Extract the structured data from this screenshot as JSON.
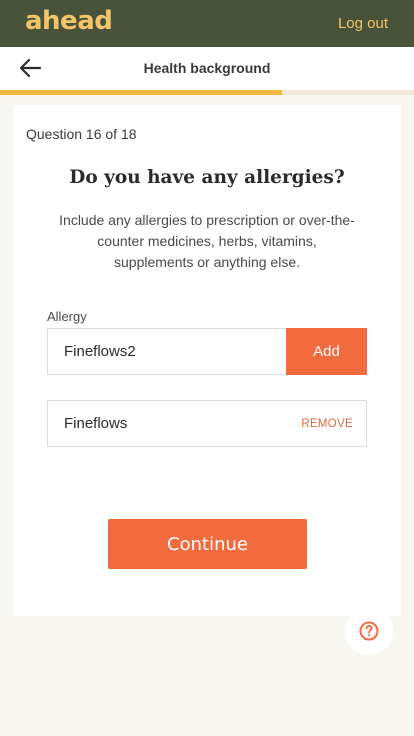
{
  "header": {
    "logo": "ahead",
    "logout_label": "Log out"
  },
  "subheader": {
    "title": "Health background",
    "back_icon": "arrow-left-icon"
  },
  "progress": {
    "current": 16,
    "total": 18,
    "fraction": 0.68
  },
  "question": {
    "number_text": "Question 16 of 18",
    "title": "Do you have any allergies?",
    "description": "Include any allergies to prescription or over-the-counter medicines, herbs, vitamins, supplements or anything else."
  },
  "allergy_input": {
    "label": "Allergy",
    "value": "Fineflows2",
    "add_label": "Add"
  },
  "allergy_list": [
    {
      "label": "Fineflows",
      "remove_label": "REMOVE"
    }
  ],
  "continue_label": "Continue",
  "help_icon": "question-circle-icon",
  "colors": {
    "header_bg": "#48533a",
    "brand_yellow": "#f2c56a",
    "progress": "#f4bb3f",
    "accent": "#f26b3f"
  }
}
